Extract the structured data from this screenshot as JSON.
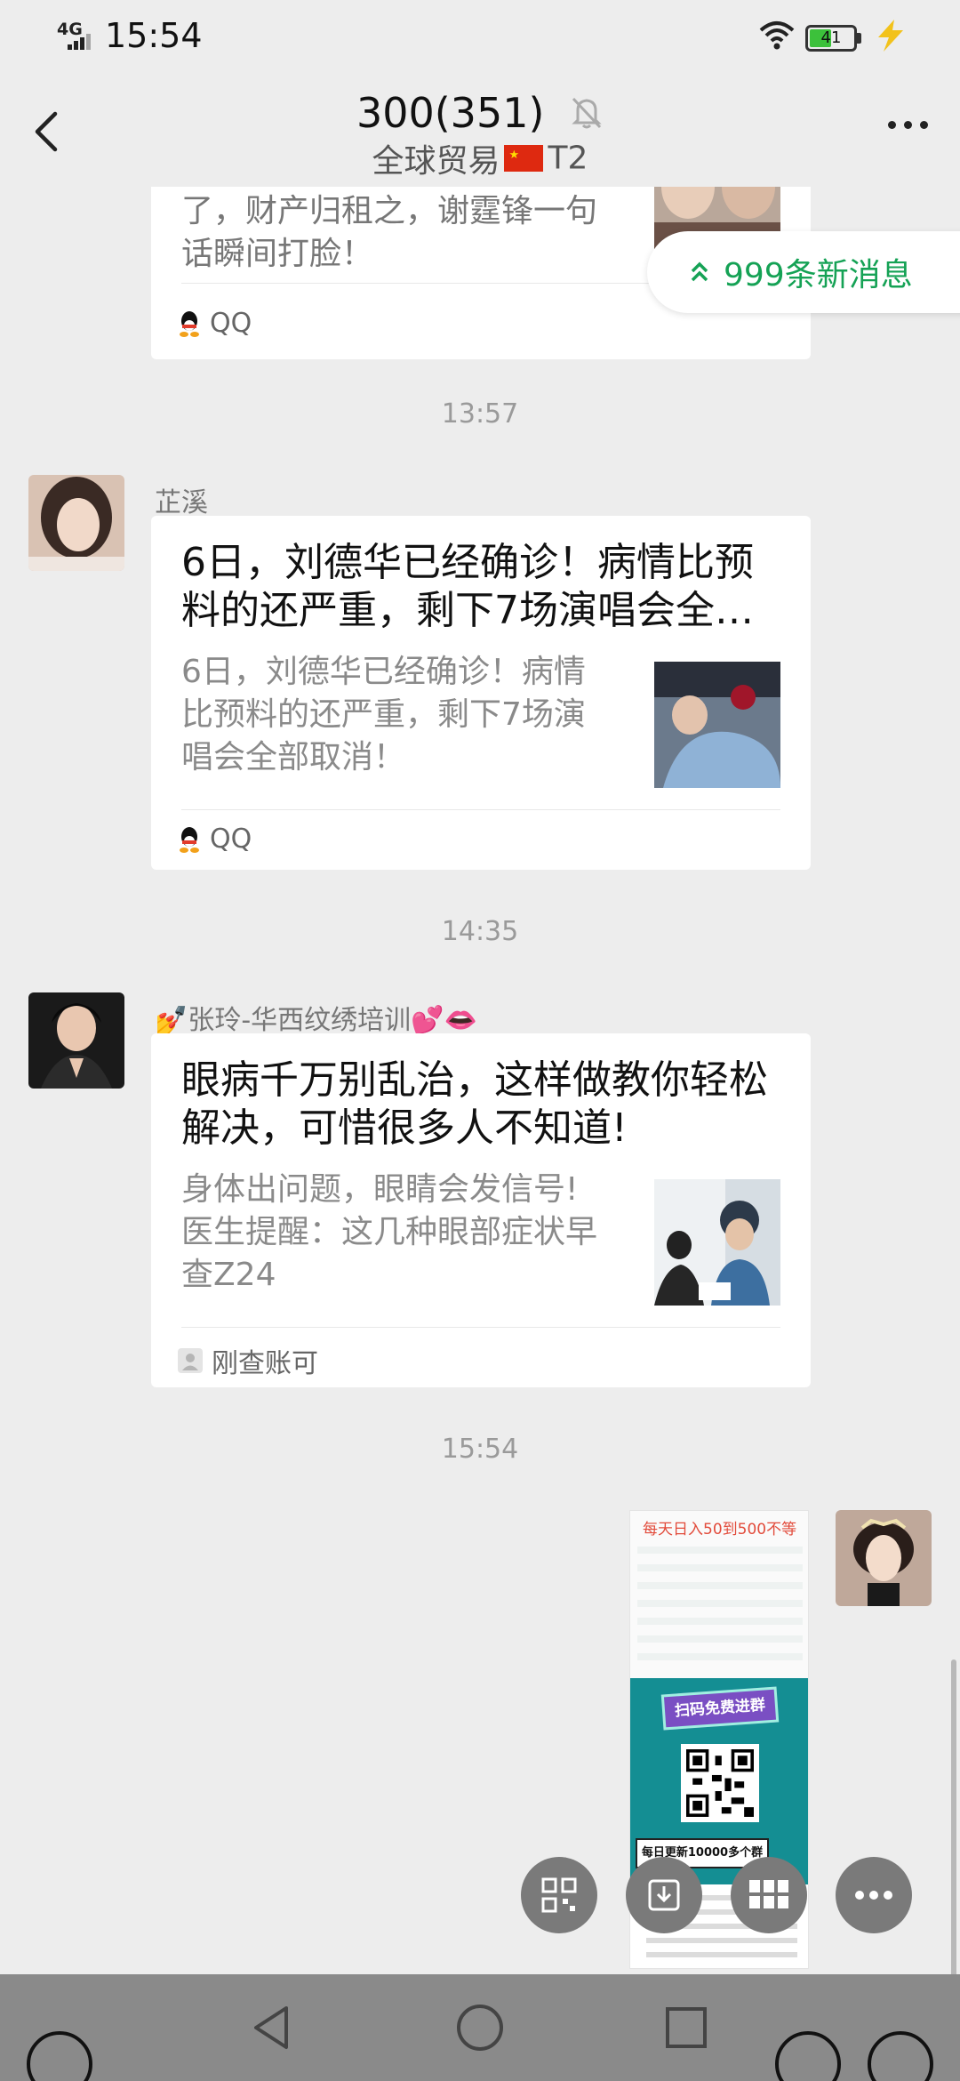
{
  "status_bar": {
    "network": "4G",
    "time": "15:54",
    "battery": "41"
  },
  "header": {
    "title": "300(351)",
    "subtitle_prefix": "全球贸易",
    "subtitle_suffix": "T2"
  },
  "new_messages": {
    "label": "999条新消息"
  },
  "messages": [
    {
      "type": "card",
      "title": "了，财产归租之，谢霆锋一句话瞬间打脸！",
      "source": "QQ"
    },
    {
      "type": "timestamp",
      "time": "13:57"
    },
    {
      "type": "card",
      "sender": "芷溪",
      "title": "6日，刘德华已经确诊！病情比预料的还严重，剩下7场演唱会全…",
      "desc": "6日，刘德华已经确诊！病情比预料的还严重，剩下7场演唱会全部取消！",
      "source": "QQ"
    },
    {
      "type": "timestamp",
      "time": "14:35"
    },
    {
      "type": "card",
      "sender": "💅张玲-华西纹绣培训💕👄",
      "title": "眼病千万别乱治，这样做教你轻松解决，可惜很多人不知道!",
      "desc": "身体出问题，眼睛会发信号!医生提醒：这几种眼部症状早查Z24",
      "source": "刚查账可"
    },
    {
      "type": "timestamp",
      "time": "15:54"
    },
    {
      "type": "image",
      "headline": "每天日入50到500不等",
      "banner": "扫码免费进群",
      "footer": "每日更新10000多个群"
    }
  ],
  "floating_actions": [
    "qr-code-icon",
    "download-icon",
    "grid-icon",
    "more-icon"
  ],
  "colors": {
    "accent_green": "#15a255",
    "background": "#ededed",
    "card": "#ffffff"
  }
}
